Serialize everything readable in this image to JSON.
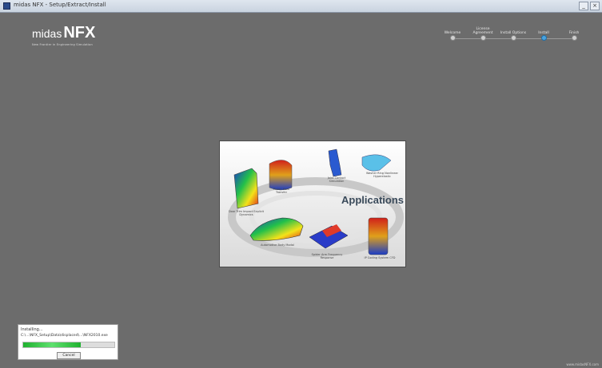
{
  "window": {
    "title": "midas NFX - Setup/Extract/Install",
    "buttons": {
      "minimize": "_",
      "close": "×"
    }
  },
  "logo": {
    "brand": "midas",
    "product": "NFX",
    "tagline": "New Frontier in Engineering Simulation"
  },
  "steps": [
    {
      "label": "Welcome",
      "active": false
    },
    {
      "label": "License Agreement",
      "active": false
    },
    {
      "label": "Install Options",
      "active": false
    },
    {
      "label": "Install",
      "active": true
    },
    {
      "label": "Finish",
      "active": false
    }
  ],
  "banner": {
    "title": "Applications",
    "labels": [
      "Door Trim Impact Explicit Dynamics",
      "Piston Heat Transfer",
      "Joint Contact Simulation",
      "Washer Ring Nonlinear Hyperelastic",
      "Automotive Body Modal",
      "Spider Arm Frequency Response",
      "IP Coding System CFD"
    ]
  },
  "progress": {
    "title": "Installing...",
    "file": "C:\\...\\NFX_Setup\\Data\\displaced\\...\\NFX2010.exe",
    "percent": 0.63,
    "cancel_label": "Cancel"
  },
  "footer": {
    "watermark": "www.midasNFX.com"
  }
}
